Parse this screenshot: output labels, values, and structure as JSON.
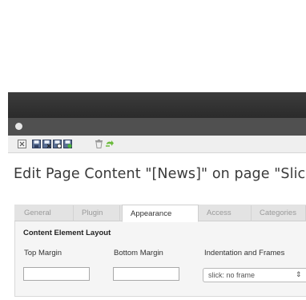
{
  "window": {
    "title": "Edit Page Content \"[News]\" on page \"Slick"
  },
  "colors": {
    "topbar": "#2f2f2f",
    "docbar": "#505050",
    "toolbar": "#efefef",
    "panel": "#f5f5f5",
    "active_tab": "#ffffff"
  },
  "toolbar": {
    "icons": [
      "close-icon",
      "save-icon",
      "save-and-close-icon",
      "save-and-view-icon",
      "save-and-new-icon",
      "delete-icon",
      "undo-icon"
    ]
  },
  "tabs": [
    {
      "label": "General",
      "active": false
    },
    {
      "label": "Plugin",
      "active": false
    },
    {
      "label": "Appearance",
      "active": true
    },
    {
      "label": "Access",
      "active": false
    },
    {
      "label": "Categories",
      "active": false
    }
  ],
  "form": {
    "section_heading": "Content Element Layout",
    "top_margin": {
      "label": "Top Margin",
      "value": ""
    },
    "bottom_margin": {
      "label": "Bottom Margin",
      "value": ""
    },
    "indentation": {
      "label": "Indentation and Frames",
      "selected": "slick: no frame"
    }
  }
}
